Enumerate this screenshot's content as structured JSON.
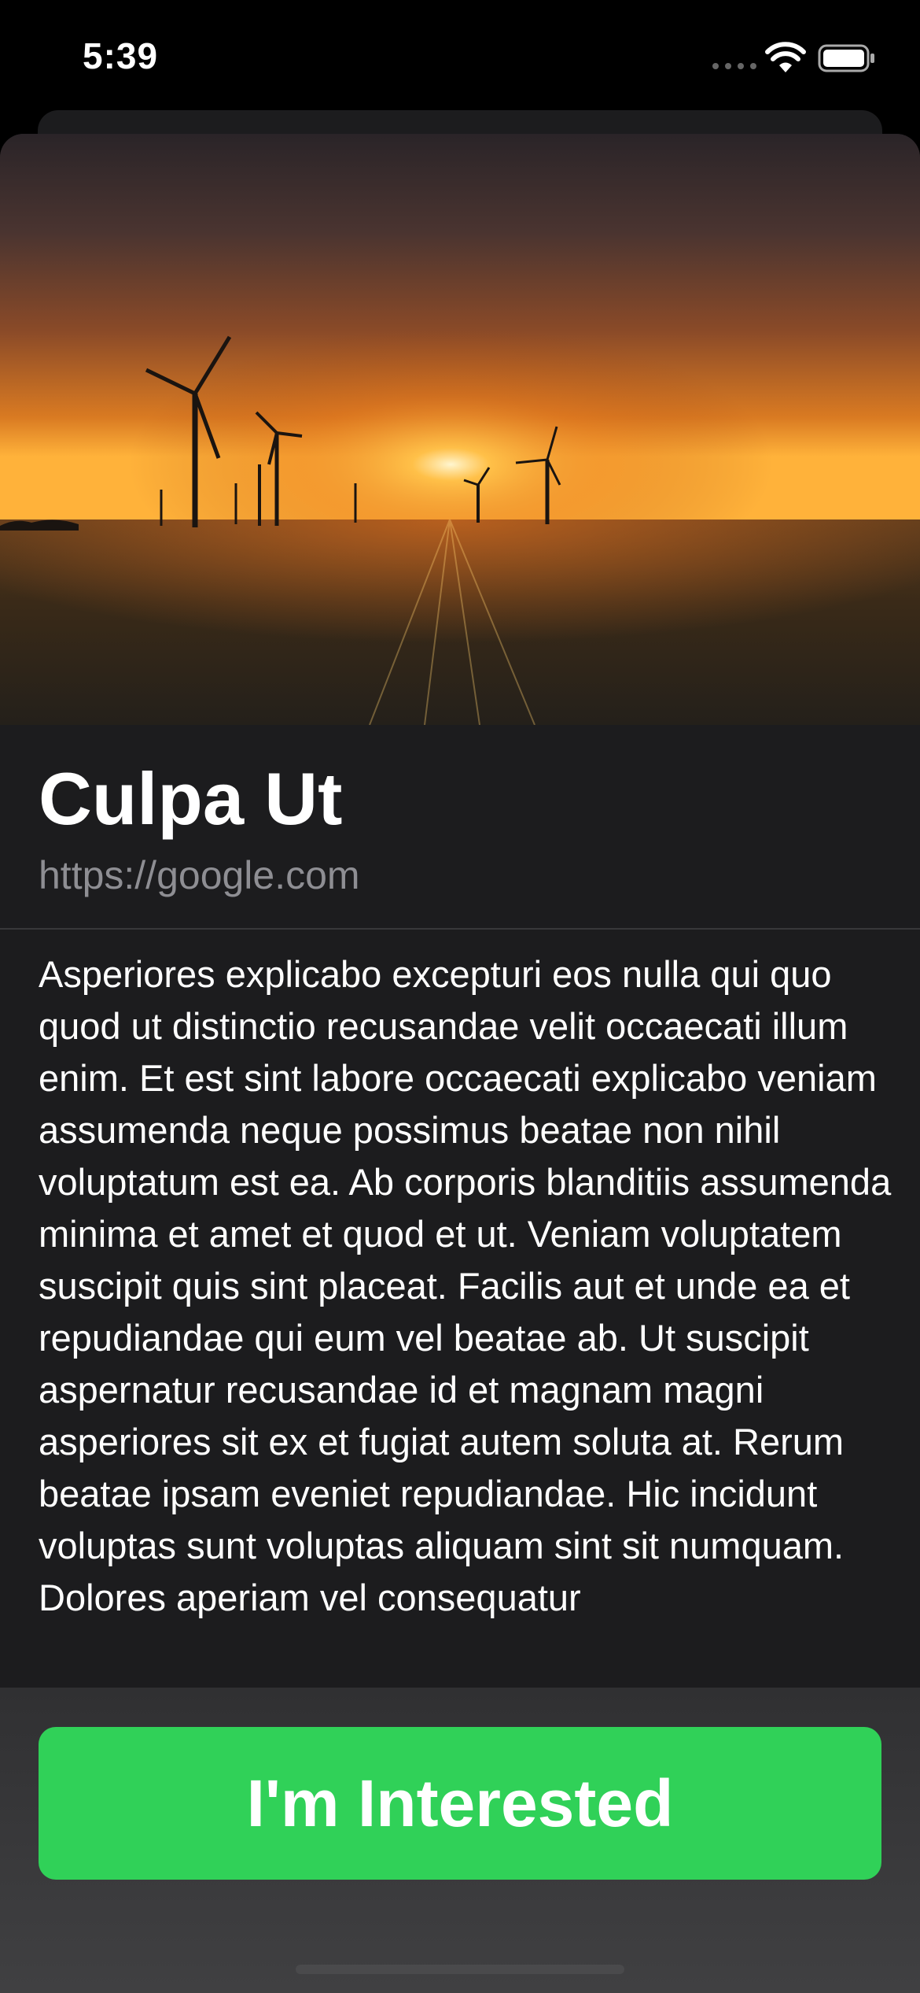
{
  "status_bar": {
    "time": "5:39"
  },
  "card": {
    "title": "Culpa Ut",
    "url": "https://google.com",
    "description": "Asperiores explicabo excepturi eos nulla qui quo quod ut distinctio recusandae velit occaecati illum enim. Et est sint labore occaecati explicabo veniam assumenda neque possimus beatae non nihil voluptatum est ea. Ab corporis blanditiis assumenda minima et amet et quod et ut. Veniam voluptatem suscipit quis sint placeat. Facilis aut et unde ea et repudiandae qui eum vel beatae ab. Ut suscipit aspernatur recusandae id et magnam magni asperiores sit ex et fugiat autem soluta at. Rerum beatae ipsam eveniet repudiandae. Hic incidunt voluptas sunt voluptas aliquam sint sit numquam. Dolores aperiam vel consequatur"
  },
  "cta": {
    "label": "I'm Interested"
  },
  "colors": {
    "accent": "#30d158",
    "sheet_background": "#1c1c1e",
    "secondary_text": "#8e8e93"
  }
}
